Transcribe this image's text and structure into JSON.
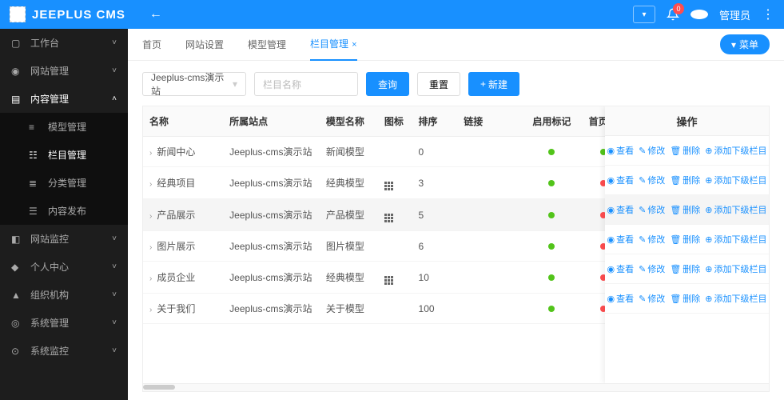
{
  "header": {
    "brand": "JEEPLUS CMS",
    "badge": "0",
    "user": "管理员"
  },
  "sidebar": {
    "items": [
      {
        "icon": "▢",
        "label": "工作台",
        "expandable": true
      },
      {
        "icon": "◉",
        "label": "网站管理",
        "expandable": true
      },
      {
        "icon": "▤",
        "label": "内容管理",
        "expandable": true,
        "active": true,
        "open": true
      },
      {
        "icon": "◧",
        "label": "网站监控",
        "expandable": true
      },
      {
        "icon": "◆",
        "label": "个人中心",
        "expandable": true
      },
      {
        "icon": "▲",
        "label": "组织机构",
        "expandable": true
      },
      {
        "icon": "◎",
        "label": "系统管理",
        "expandable": true
      },
      {
        "icon": "⊙",
        "label": "系统监控",
        "expandable": true
      }
    ],
    "subItems": [
      {
        "icon": "≡",
        "label": "模型管理"
      },
      {
        "icon": "☷",
        "label": "栏目管理",
        "current": true
      },
      {
        "icon": "≣",
        "label": "分类管理"
      },
      {
        "icon": "☰",
        "label": "内容发布"
      }
    ]
  },
  "tabs": {
    "items": [
      {
        "label": "首页"
      },
      {
        "label": "网站设置"
      },
      {
        "label": "模型管理"
      },
      {
        "label": "栏目管理",
        "active": true,
        "closable": true
      }
    ],
    "menuBtn": "菜单"
  },
  "toolbar": {
    "site": "Jeeplus-cms演示站",
    "placeholder": "栏目名称",
    "search": "查询",
    "reset": "重置",
    "create": "新建"
  },
  "table": {
    "headers": {
      "name": "名称",
      "site": "所属站点",
      "model": "模型名称",
      "icon": "图标",
      "sort": "排序",
      "link": "链接",
      "enabled": "启用标记",
      "showHome": "首页显",
      "action": "操作"
    },
    "actions": {
      "view": "查看",
      "edit": "修改",
      "delete": "删除",
      "addSub": "添加下级栏目"
    },
    "rows": [
      {
        "name": "新闻中心",
        "site": "Jeeplus-cms演示站",
        "model": "新闻模型",
        "hasIcon": false,
        "sort": "0",
        "link": "",
        "enabled": "g",
        "showHome": "g"
      },
      {
        "name": "经典项目",
        "site": "Jeeplus-cms演示站",
        "model": "经典模型",
        "hasIcon": true,
        "sort": "3",
        "link": "",
        "enabled": "g",
        "showHome": "r"
      },
      {
        "name": "产品展示",
        "site": "Jeeplus-cms演示站",
        "model": "产品模型",
        "hasIcon": true,
        "sort": "5",
        "link": "",
        "enabled": "g",
        "showHome": "r",
        "hl": true
      },
      {
        "name": "图片展示",
        "site": "Jeeplus-cms演示站",
        "model": "图片模型",
        "hasIcon": false,
        "sort": "6",
        "link": "",
        "enabled": "g",
        "showHome": "r"
      },
      {
        "name": "成员企业",
        "site": "Jeeplus-cms演示站",
        "model": "经典模型",
        "hasIcon": true,
        "sort": "10",
        "link": "",
        "enabled": "g",
        "showHome": "r"
      },
      {
        "name": "关于我们",
        "site": "Jeeplus-cms演示站",
        "model": "关于模型",
        "hasIcon": false,
        "sort": "100",
        "link": "",
        "enabled": "g",
        "showHome": "r"
      }
    ]
  }
}
